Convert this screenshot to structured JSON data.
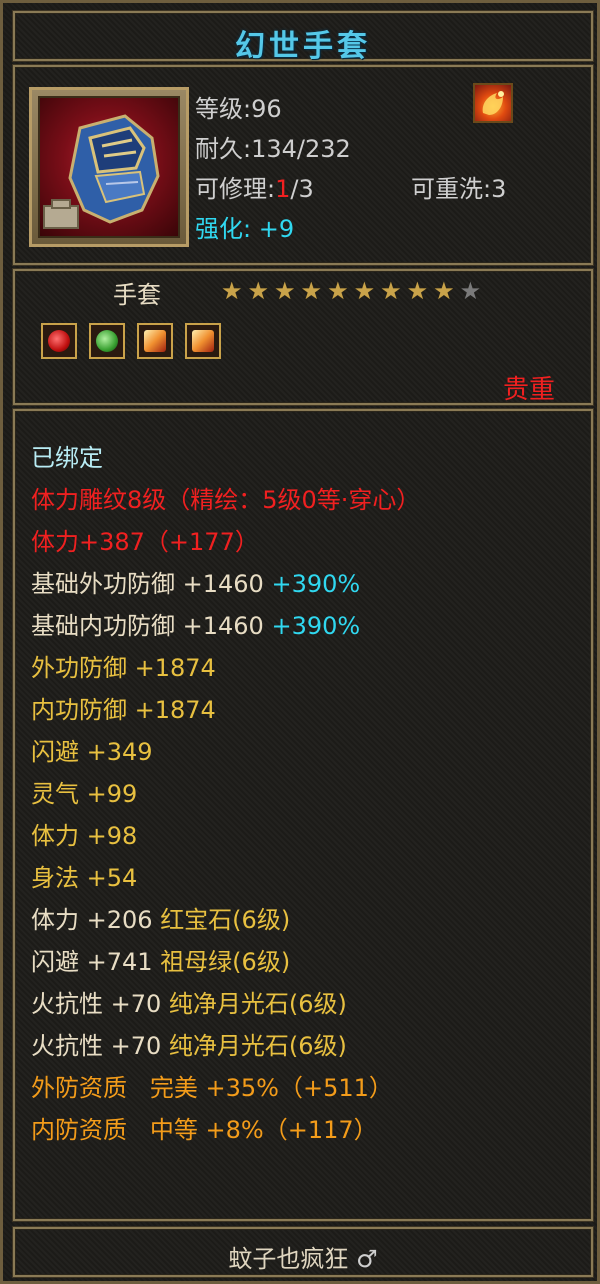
{
  "title": "幻世手套",
  "header": {
    "level_label": "等级:",
    "level_value": "96",
    "durability_label": "耐久:",
    "durability_value": "134/232",
    "repair_label": "可修理:",
    "repair_current": "1",
    "repair_max": "/3",
    "rewash_label": "可重洗:",
    "rewash_value": "3",
    "enhance_label": "强化:",
    "enhance_value": "+9",
    "item_icon": "gauntlet-icon",
    "badge_icon": "fire-phoenix-icon"
  },
  "type_section": {
    "type_name": "手套",
    "stars_filled": 9,
    "stars_total": 10,
    "rarity": "贵重",
    "gems": [
      {
        "icon": "red-gem-icon",
        "color": "#d42020"
      },
      {
        "icon": "green-gem-icon",
        "color": "#3aa030"
      },
      {
        "icon": "moonstone-icon",
        "color": "#e8a040"
      },
      {
        "icon": "moonstone-icon",
        "color": "#e8a040"
      }
    ]
  },
  "attributes": {
    "bound": "已绑定",
    "engrave": "体力雕纹8级（精绘：5级0等·穿心）",
    "stamina_main": "体力+387（+177）",
    "base_ext_def": {
      "label": "基础外功防御",
      "value": "+1460",
      "bonus": "+390%"
    },
    "base_int_def": {
      "label": "基础内功防御",
      "value": "+1460",
      "bonus": "+390%"
    },
    "ext_def": "外功防御 +1874",
    "int_def": "内功防御 +1874",
    "dodge": "闪避 +349",
    "spirit": "灵气 +99",
    "stamina": "体力 +98",
    "agility": "身法 +54",
    "gem_lines": [
      {
        "stat": "体力 +206",
        "gem": "红宝石(6级)"
      },
      {
        "stat": "闪避 +741",
        "gem": "祖母绿(6级)"
      },
      {
        "stat": "火抗性 +70",
        "gem": "纯净月光石(6级)"
      },
      {
        "stat": "火抗性 +70",
        "gem": "纯净月光石(6级)"
      }
    ],
    "aptitude_lines": [
      {
        "label": "外防资质",
        "grade": "完美",
        "bonus": "+35%（+511）"
      },
      {
        "label": "内防资质",
        "grade": "中等",
        "bonus": "+8%（+117）"
      }
    ]
  },
  "footer": {
    "owner": "蚊子也疯狂",
    "gender_symbol": "♂"
  },
  "colors": {
    "title": "#55c8e8",
    "gold": "#e8c040",
    "red": "#f02020",
    "cyan": "#30d8f0",
    "orange": "#f39c1a"
  }
}
